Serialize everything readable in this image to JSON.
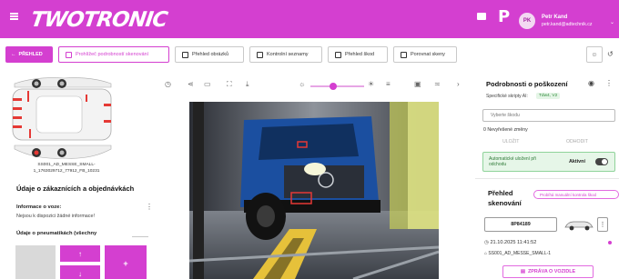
{
  "header": {
    "logo": "TWOTRONIC",
    "avatar_initials": "PK",
    "user_name": "Petr Kand",
    "user_email": "petr.kand@adtechnik.cz"
  },
  "toolbar": {
    "back_label": "PŘEHLED",
    "buttons": [
      {
        "label": "Prohlížeč podrobností skenování",
        "active": true
      },
      {
        "label": "Přehled obrázků",
        "active": false
      },
      {
        "label": "Kontrolní seznamy",
        "active": false
      },
      {
        "label": "Přehled škod",
        "active": false
      },
      {
        "label": "Porovnat skeny",
        "active": false
      }
    ]
  },
  "left": {
    "car_caption_line1": "SS001_AD_MESSE_SMALL-",
    "car_caption_line2": "1_1763029712_77912_FB_10231",
    "section_title": "Údaje o zákaznících a objednávkách",
    "info_label": "Informace o voze:",
    "info_text": "Nejsou k dispozici žádné informace!",
    "tires_label": "Údaje o pneumatikách (všechny"
  },
  "right": {
    "title": "Podrobnosti o poškození",
    "spec_label": "Specifické skripty AI:",
    "spec_tag": "Tdw4, V2",
    "select_placeholder": "Vyberte škodu",
    "unresolved": "0 Nevyřešené změny",
    "action1": "ULOŽIT",
    "action2": "ODHODIT",
    "auto_text": "Automatické uložení při odchodu",
    "auto_value": "Aktivní",
    "scan_title": "Přehled skenování",
    "badge": "Probíhá manuální kontrola škod",
    "plate": "8P84189",
    "datetime": "21.10.2025 11:41:52",
    "device": "SS001_AD_MESSE_SMALL-1",
    "report_button": "ZPRÁVA O VOZIDLE"
  },
  "colors": {
    "brand": "#d43fd0",
    "auto_bg": "#e6f6e8"
  }
}
